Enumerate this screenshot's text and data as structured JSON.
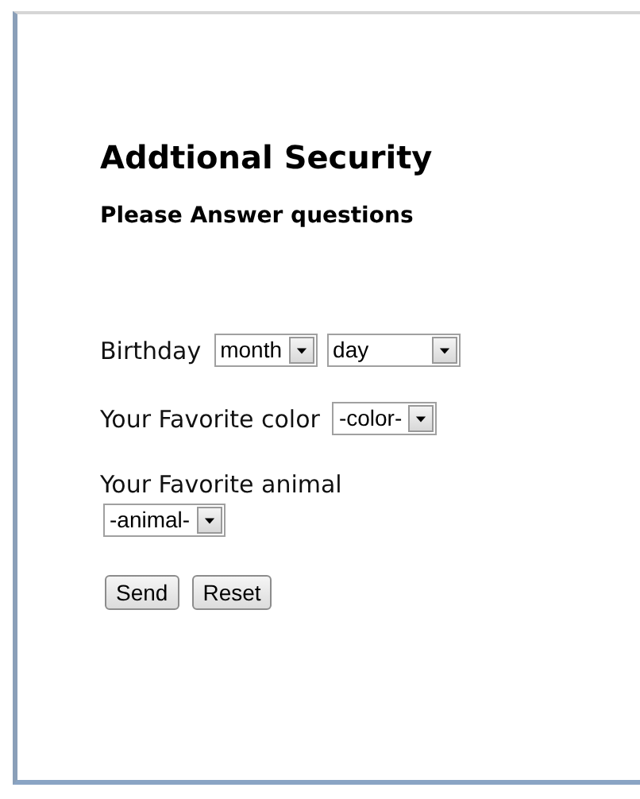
{
  "heading": "Addtional Security",
  "subheading": "Please Answer questions",
  "fields": [
    {
      "label": "Birthday",
      "kind": "inline",
      "selects": [
        "month",
        "day"
      ]
    },
    {
      "label": "Your Favorite color",
      "kind": "inline",
      "selects": [
        "-color-"
      ]
    },
    {
      "label": "Your Favorite animal",
      "kind": "stacked",
      "selects": [
        "-animal-"
      ]
    }
  ],
  "buttons": [
    "Send",
    "Reset"
  ]
}
